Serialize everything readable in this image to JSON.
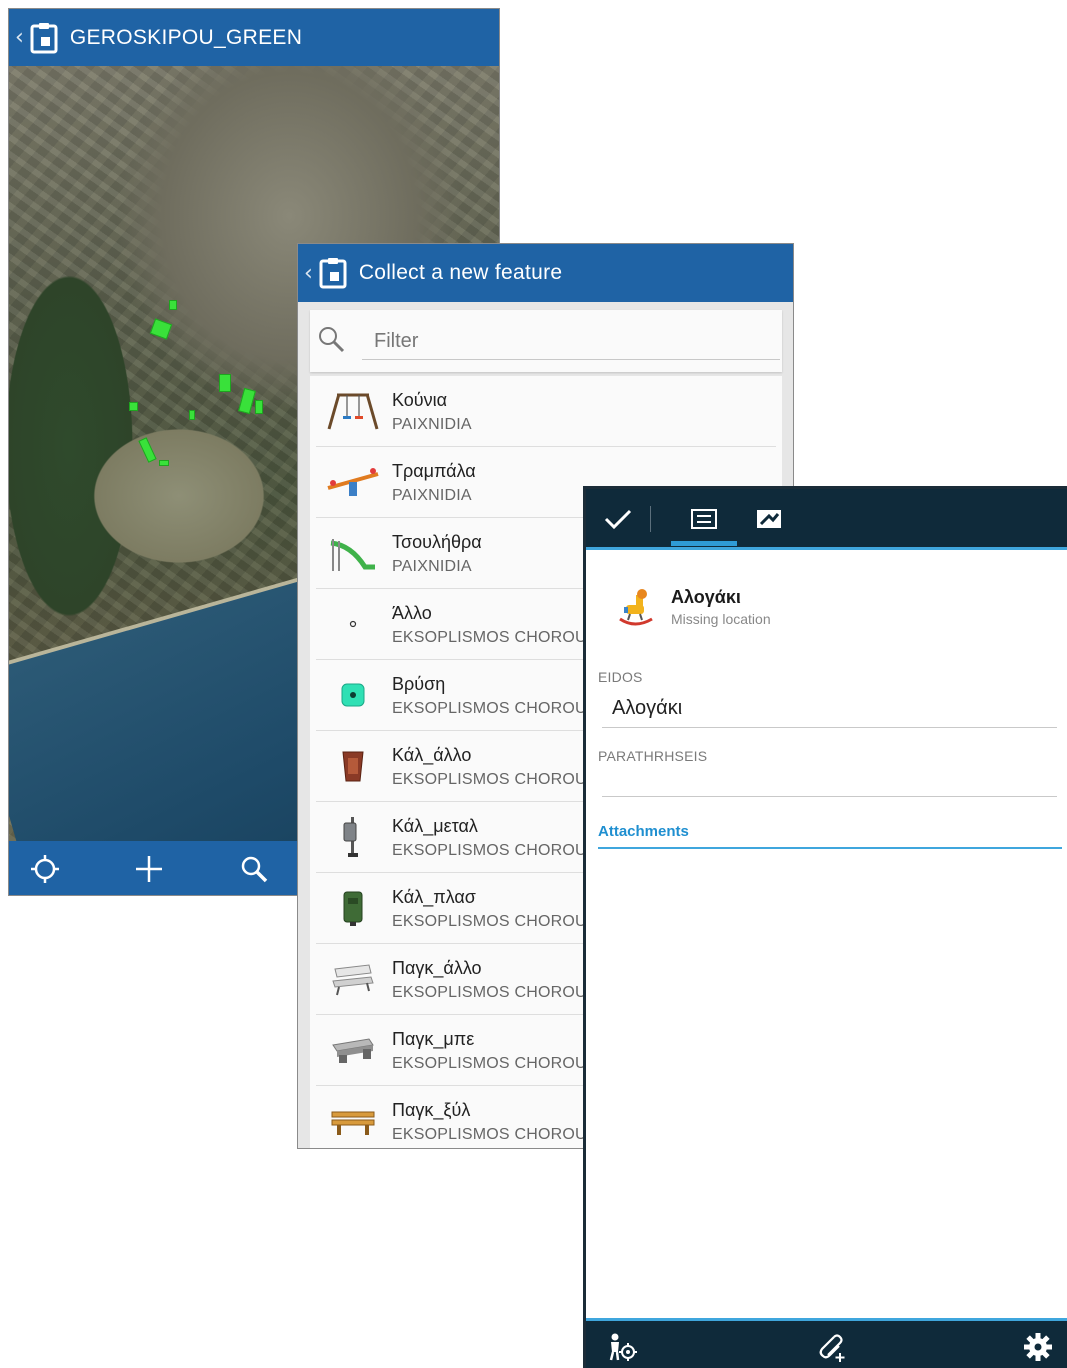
{
  "map_screen": {
    "title": "GEROSKIPOU_GREEN",
    "back_glyph": "‹",
    "toolbar": {
      "locate_icon": "crosshair-icon",
      "add_icon": "plus-icon",
      "search_icon": "search-icon"
    }
  },
  "collect_screen": {
    "title": "Collect a new feature",
    "back_glyph": "‹",
    "filter": {
      "placeholder": "Filter",
      "value": ""
    },
    "features": [
      {
        "name": "Κούνια",
        "category": "PAIXNIDIA",
        "icon": "swing-icon"
      },
      {
        "name": "Τραμπάλα",
        "category": "PAIXNIDIA",
        "icon": "seesaw-icon"
      },
      {
        "name": "Τσουλήθρα",
        "category": "PAIXNIDIA",
        "icon": "slide-icon"
      },
      {
        "name": "Άλλο",
        "category": "EKSOPLISMOS CHOROU",
        "icon": "dot-icon"
      },
      {
        "name": "Βρύση",
        "category": "EKSOPLISMOS CHOROU",
        "icon": "fountain-icon"
      },
      {
        "name": "Κάλ_άλλο",
        "category": "EKSOPLISMOS CHOROU",
        "icon": "bin-other-icon"
      },
      {
        "name": "Κάλ_μεταλ",
        "category": "EKSOPLISMOS CHOROU",
        "icon": "bin-metal-icon"
      },
      {
        "name": "Κάλ_πλασ",
        "category": "EKSOPLISMOS CHOROU",
        "icon": "bin-plastic-icon"
      },
      {
        "name": "Παγκ_άλλο",
        "category": "EKSOPLISMOS CHOROU",
        "icon": "bench-other-icon"
      },
      {
        "name": "Παγκ_μπε",
        "category": "EKSOPLISMOS CHOROU",
        "icon": "bench-concrete-icon"
      },
      {
        "name": "Παγκ_ξύλ",
        "category": "EKSOPLISMOS CHOROU",
        "icon": "bench-wood-icon"
      }
    ]
  },
  "form_screen": {
    "header": {
      "title": "Αλογάκι",
      "subtitle": "Missing location",
      "icon": "rocking-horse-icon"
    },
    "fields": [
      {
        "label": "EIDOS",
        "value": "Αλογάκι"
      },
      {
        "label": "PARATHRHSEIS",
        "value": ""
      }
    ],
    "attachments_label": "Attachments",
    "toolbar_top": {
      "submit_icon": "checkmark-icon",
      "form_tab_icon": "form-tab-icon",
      "map_tab_icon": "map-tab-icon"
    },
    "toolbar_bottom": {
      "location_icon": "collect-location-icon",
      "attach_icon": "paperclip-add-icon",
      "settings_icon": "gear-icon"
    }
  },
  "colors": {
    "app_blue": "#1f63a5",
    "form_dark": "#0f2a3a",
    "accent_cyan": "#3fa6dd",
    "link_blue": "#1f8fd0",
    "feature_green": "#39e13a"
  }
}
